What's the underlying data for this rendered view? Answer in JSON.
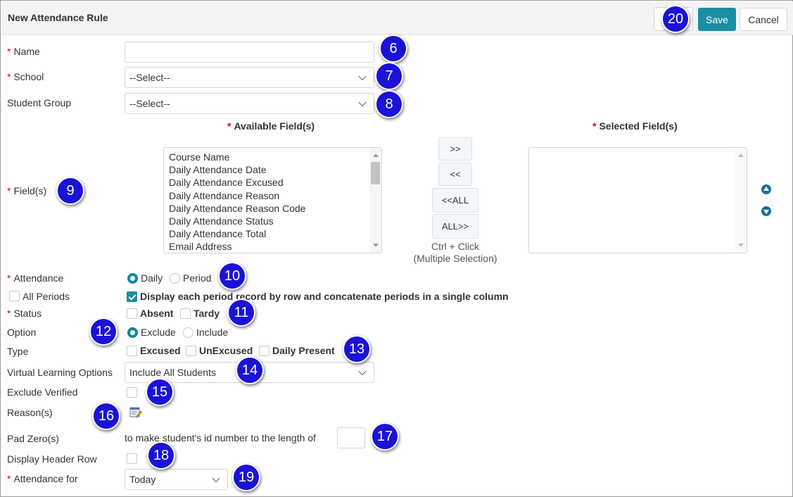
{
  "title": "New Attendance Rule",
  "buttons": {
    "save": "Save",
    "cancel": "Cancel"
  },
  "form": {
    "name": {
      "label": "Name",
      "value": ""
    },
    "school": {
      "label": "School",
      "value": "--Select--"
    },
    "student_group": {
      "label": "Student Group",
      "value": "--Select--"
    },
    "fields": {
      "label": "Field(s)",
      "available_header": "Available Field(s)",
      "selected_header": "Selected Field(s)",
      "available": [
        "Course Name",
        "Daily Attendance Date",
        "Daily Attendance Excused",
        "Daily Attendance Reason",
        "Daily Attendance Reason Code",
        "Daily Attendance Status",
        "Daily Attendance Total",
        "Email Address"
      ],
      "selected": [],
      "move_buttons": [
        ">>",
        "<<",
        "<<ALL",
        "ALL>>"
      ],
      "hint_line1": "Ctrl + Click",
      "hint_line2": "(Multiple Selection)",
      "move_up_icon": "arrow-up-circle-icon",
      "move_down_icon": "arrow-down-circle-icon"
    },
    "attendance": {
      "label": "Attendance",
      "options": [
        "Daily",
        "Period"
      ],
      "selected": "Daily"
    },
    "all_periods": {
      "label": "All Periods",
      "checked": false,
      "display_each_label": "Display each period record by row and concatenate periods in a single column",
      "display_each_checked": true
    },
    "status": {
      "label": "Status",
      "options": [
        "Absent",
        "Tardy"
      ]
    },
    "option": {
      "label": "Option",
      "options": [
        "Exclude",
        "Include"
      ],
      "selected": "Exclude"
    },
    "type": {
      "label": "Type",
      "options": [
        "Excused",
        "UnExcused",
        "Daily Present"
      ]
    },
    "virtual_learning": {
      "label": "Virtual Learning Options",
      "value": "Include All Students"
    },
    "exclude_verified": {
      "label": "Exclude Verified",
      "checked": false
    },
    "reasons": {
      "label": "Reason(s)",
      "icon": "edit-list-icon"
    },
    "pad_zero": {
      "label": "Pad Zero(s)",
      "text": "to make student's id number to the length of",
      "value": ""
    },
    "display_header_row": {
      "label": "Display Header Row",
      "checked": false
    },
    "attendance_for": {
      "label": "Attendance for",
      "value": "Today"
    }
  },
  "callouts": [
    "6",
    "7",
    "8",
    "9",
    "10",
    "11",
    "12",
    "13",
    "14",
    "15",
    "16",
    "17",
    "18",
    "19",
    "20"
  ],
  "colors": {
    "accent": "#1a8fa0",
    "required": "#d0021b",
    "callout": "#1a12d6"
  }
}
